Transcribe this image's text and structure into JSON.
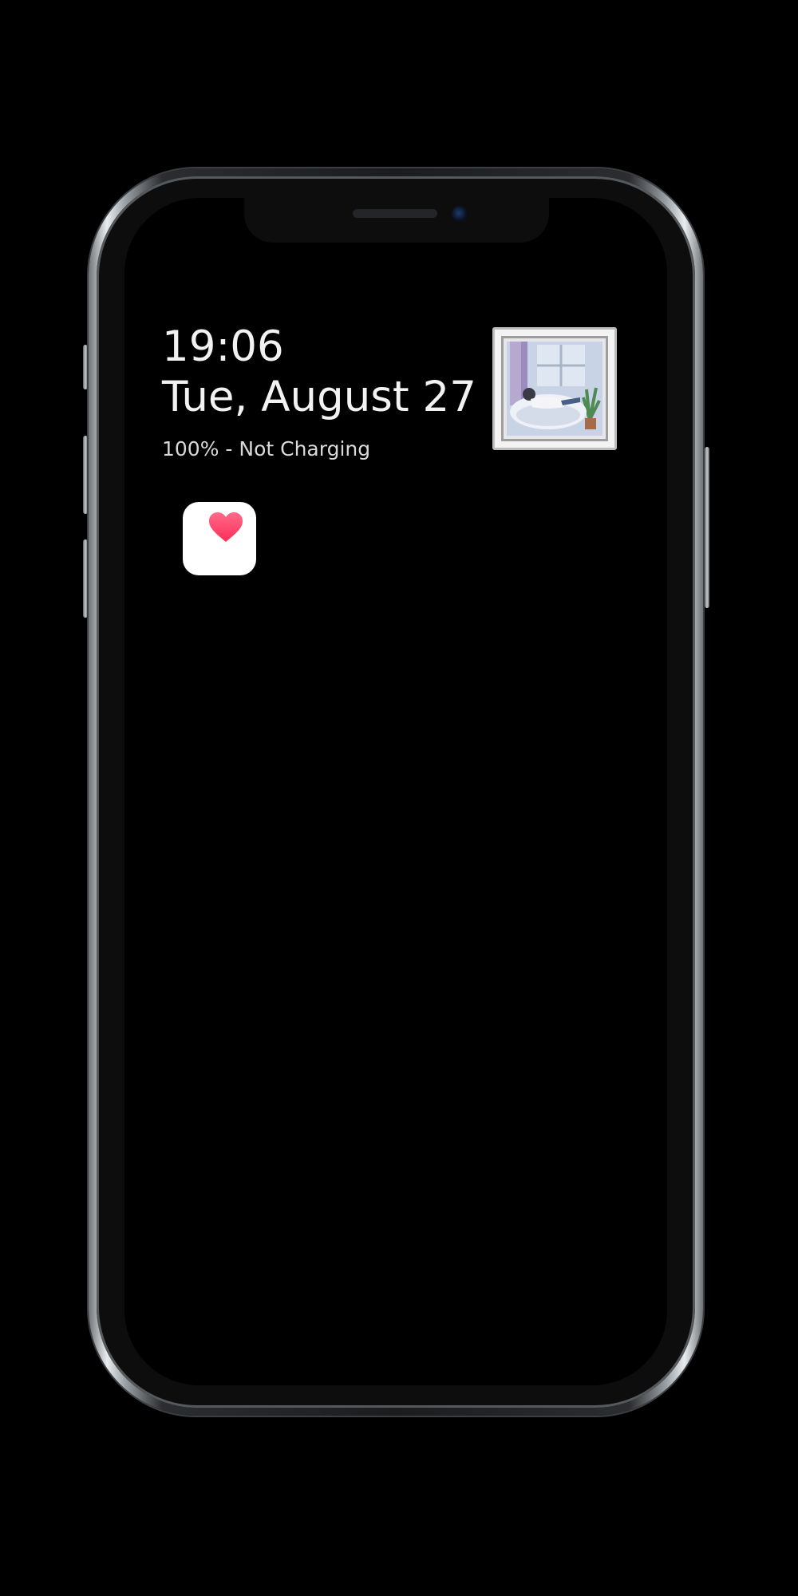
{
  "lock_screen": {
    "time": "19:06",
    "date": "Tue, August 27",
    "battery_status": "100% - Not Charging"
  },
  "widgets": {
    "photo_frame": {
      "icon": "photo-frame-widget"
    },
    "health_app": {
      "icon": "heart-icon",
      "accent_color": "#ff2d55"
    }
  },
  "theme": {
    "background": "#000000",
    "text_color": "#f2f2f2"
  }
}
